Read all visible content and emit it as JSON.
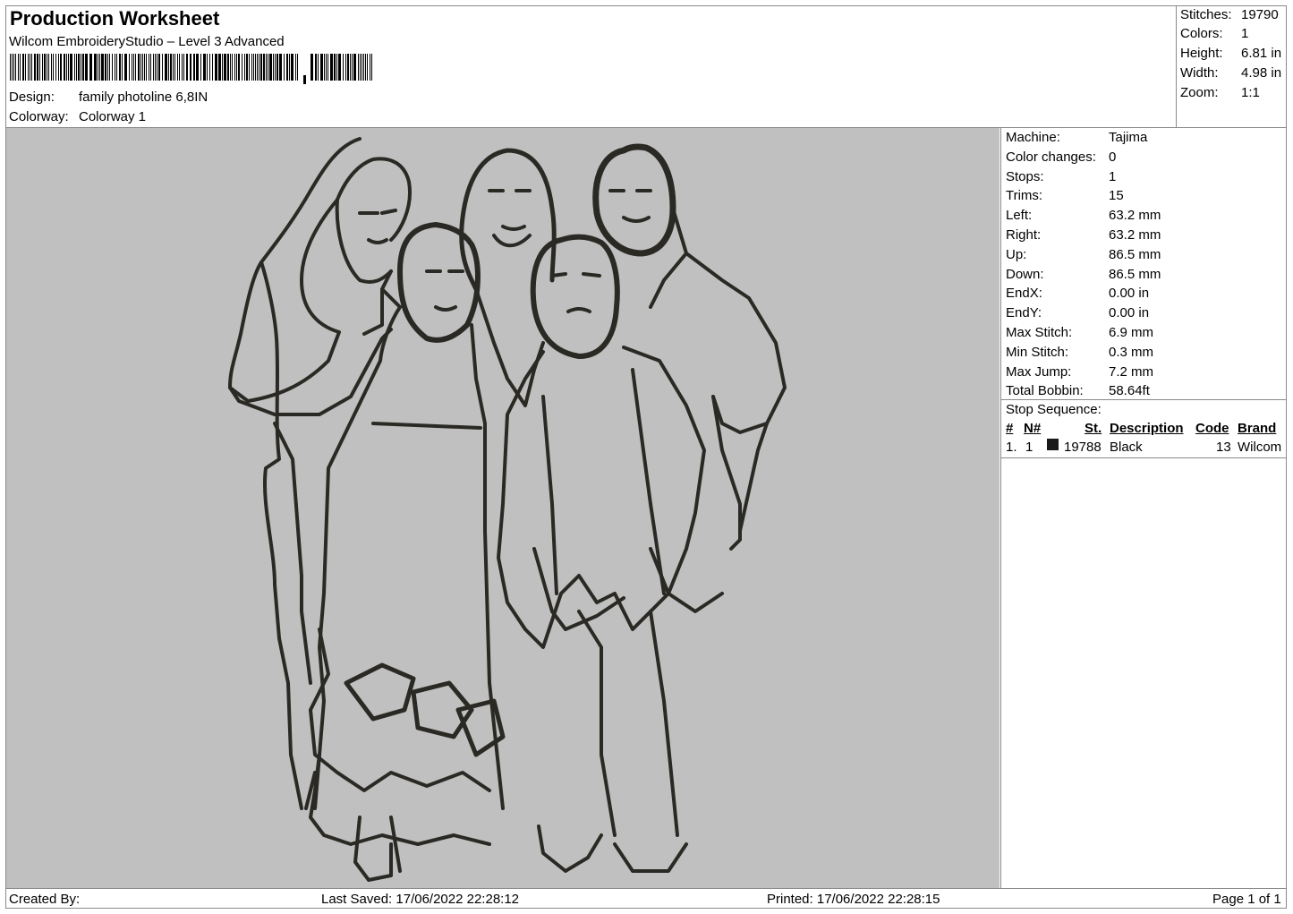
{
  "header": {
    "title": "Production Worksheet",
    "software": "Wilcom EmbroideryStudio – Level 3 Advanced",
    "design_label": "Design:",
    "design_value": "family photoline 6,8IN",
    "colorway_label": "Colorway:",
    "colorway_value": "Colorway 1"
  },
  "summary": {
    "stitches_label": "Stitches:",
    "stitches_value": "19790",
    "colors_label": "Colors:",
    "colors_value": "1",
    "height_label": "Height:",
    "height_value": "6.81 in",
    "width_label": "Width:",
    "width_value": "4.98 in",
    "zoom_label": "Zoom:",
    "zoom_value": "1:1"
  },
  "machine": {
    "machine_label": "Machine:",
    "machine_value": "Tajima",
    "color_changes_label": "Color changes:",
    "color_changes_value": "0",
    "stops_label": "Stops:",
    "stops_value": "1",
    "trims_label": "Trims:",
    "trims_value": "15",
    "left_label": "Left:",
    "left_value": "63.2 mm",
    "right_label": "Right:",
    "right_value": "63.2 mm",
    "up_label": "Up:",
    "up_value": "86.5 mm",
    "down_label": "Down:",
    "down_value": "86.5 mm",
    "endx_label": "EndX:",
    "endx_value": "0.00 in",
    "endy_label": "EndY:",
    "endy_value": "0.00 in",
    "max_stitch_label": "Max Stitch:",
    "max_stitch_value": "6.9 mm",
    "min_stitch_label": "Min Stitch:",
    "min_stitch_value": "0.3 mm",
    "max_jump_label": "Max Jump:",
    "max_jump_value": "7.2 mm",
    "total_bobbin_label": "Total Bobbin:",
    "total_bobbin_value": "58.64ft"
  },
  "stop_sequence": {
    "label": "Stop Sequence:",
    "columns": {
      "index": "#",
      "needle": "N#",
      "stitches": "St.",
      "description": "Description",
      "code": "Code",
      "brand": "Brand"
    },
    "rows": [
      {
        "index": "1.",
        "needle": "1",
        "color": "#1a1a1a",
        "stitches": "19788",
        "description": "Black",
        "code": "13",
        "brand": "Wilcom"
      }
    ]
  },
  "design_preview": {
    "background": "#c0c0c0",
    "thread_color": "#2a2924"
  },
  "footer": {
    "created_by": "Created By:",
    "last_saved": "Last Saved: 17/06/2022 22:28:12",
    "printed": "Printed: 17/06/2022 22:28:15",
    "page": "Page 1 of 1"
  }
}
